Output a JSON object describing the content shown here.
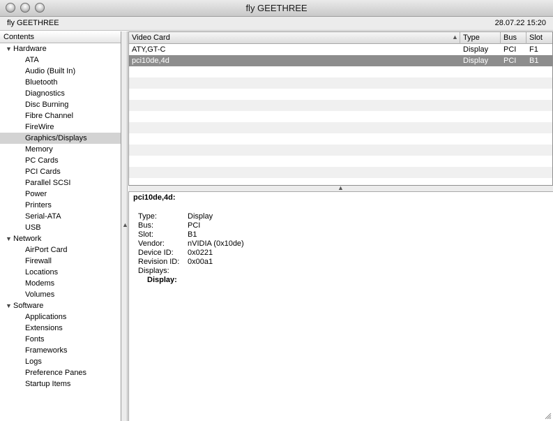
{
  "window": {
    "title": "fly GEETHREE"
  },
  "infobar": {
    "machine": "fly GEETHREE",
    "datetime": "28.07.22 15:20"
  },
  "sidebar": {
    "header": "Contents",
    "groups": [
      {
        "label": "Hardware",
        "items": [
          "ATA",
          "Audio (Built In)",
          "Bluetooth",
          "Diagnostics",
          "Disc Burning",
          "Fibre Channel",
          "FireWire",
          "Graphics/Displays",
          "Memory",
          "PC Cards",
          "PCI Cards",
          "Parallel SCSI",
          "Power",
          "Printers",
          "Serial-ATA",
          "USB"
        ]
      },
      {
        "label": "Network",
        "items": [
          "AirPort Card",
          "Firewall",
          "Locations",
          "Modems",
          "Volumes"
        ]
      },
      {
        "label": "Software",
        "items": [
          "Applications",
          "Extensions",
          "Fonts",
          "Frameworks",
          "Logs",
          "Preference Panes",
          "Startup Items"
        ]
      }
    ],
    "selected": "Graphics/Displays"
  },
  "table": {
    "columns": [
      "Video Card",
      "Type",
      "Bus",
      "Slot"
    ],
    "rows": [
      {
        "card": "ATY,GT-C",
        "type": "Display",
        "bus": "PCI",
        "slot": "F1"
      },
      {
        "card": "pci10de,4d",
        "type": "Display",
        "bus": "PCI",
        "slot": "B1"
      }
    ],
    "selected_row": 1
  },
  "details": {
    "title": "pci10de,4d:",
    "fields": [
      {
        "label": "Type:",
        "value": "Display"
      },
      {
        "label": "Bus:",
        "value": "PCI"
      },
      {
        "label": "Slot:",
        "value": "B1"
      },
      {
        "label": "Vendor:",
        "value": "nVIDIA (0x10de)"
      },
      {
        "label": "Device ID:",
        "value": "0x0221"
      },
      {
        "label": "Revision ID:",
        "value": "0x00a1"
      },
      {
        "label": "Displays:",
        "value": ""
      }
    ],
    "subheading": "Display:"
  },
  "icons": {
    "close": "close-icon",
    "minimize": "minimize-icon",
    "zoom": "zoom-icon",
    "disclosure": "disclosure-triangle-icon",
    "sort": "sort-ascending-icon",
    "splitter": "splitter-handle-icon",
    "resize": "resize-grip-icon"
  }
}
